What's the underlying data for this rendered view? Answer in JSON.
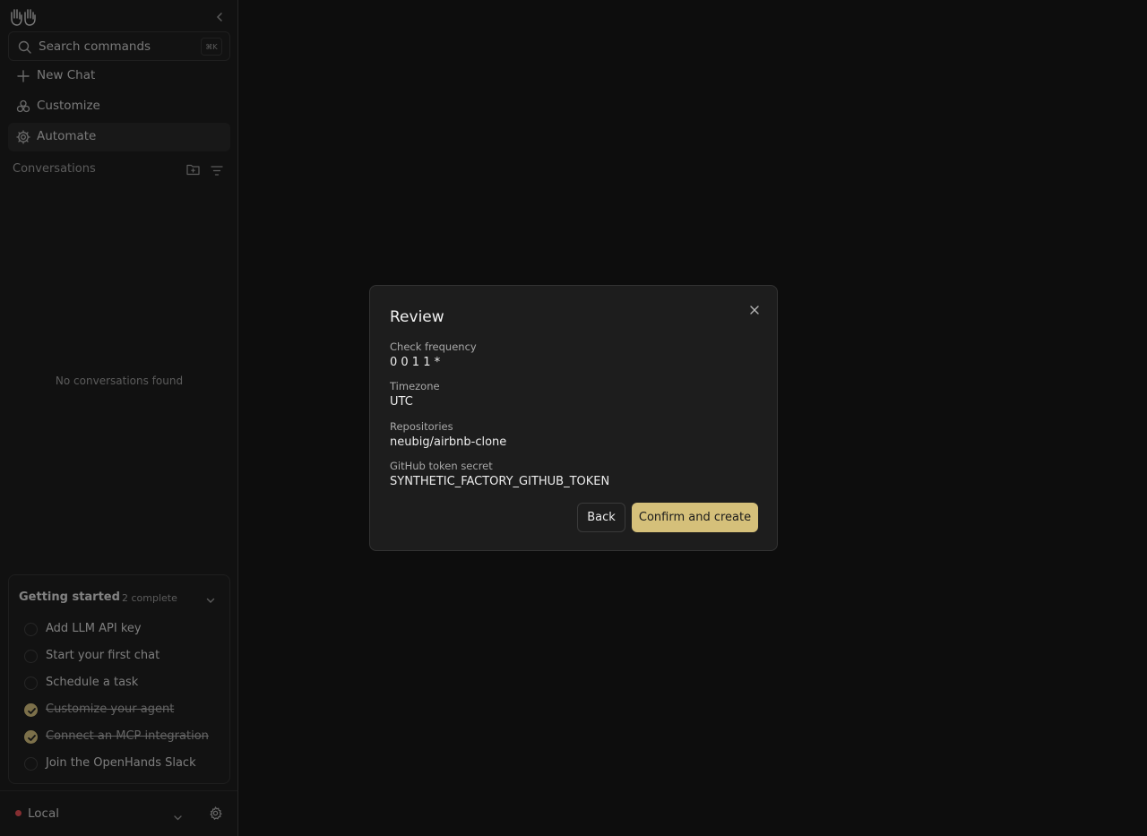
{
  "sidebar": {
    "logo_icon": "openhands-hands-icon",
    "search": {
      "label": "Search commands",
      "shortcut": "⌘K"
    },
    "nav": [
      {
        "label": "New Chat",
        "icon": "plus-icon"
      },
      {
        "label": "Customize",
        "icon": "customize-icon"
      },
      {
        "label": "Automate",
        "icon": "automate-gear-icon",
        "active": true
      }
    ],
    "conversations": {
      "header": "Conversations",
      "empty": "No conversations found"
    },
    "getting_started": {
      "title": "Getting started",
      "count": "2 complete",
      "items": [
        {
          "label": "Add LLM API key",
          "done": false
        },
        {
          "label": "Start your first chat",
          "done": false
        },
        {
          "label": "Schedule a task",
          "done": false
        },
        {
          "label": "Customize your agent",
          "done": true
        },
        {
          "label": "Connect an MCP integration",
          "done": true
        },
        {
          "label": "Join the OpenHands Slack",
          "done": false
        }
      ]
    },
    "footer": {
      "runtime": "Local",
      "status_color": "#e5484d"
    }
  },
  "modal": {
    "title": "Review",
    "fields": [
      {
        "label": "Check frequency",
        "value": "0 0 1 1 *"
      },
      {
        "label": "Timezone",
        "value": "UTC"
      },
      {
        "label": "Repositories",
        "value": "neubig/airbnb-clone"
      },
      {
        "label": "GitHub token secret",
        "value": "SYNTHETIC_FACTORY_GITHUB_TOKEN"
      }
    ],
    "back_label": "Back",
    "confirm_label": "Confirm and create"
  },
  "colors": {
    "accent": "#d5c07a",
    "background": "#0d0d0d",
    "modal_bg": "#1d1d1d"
  }
}
